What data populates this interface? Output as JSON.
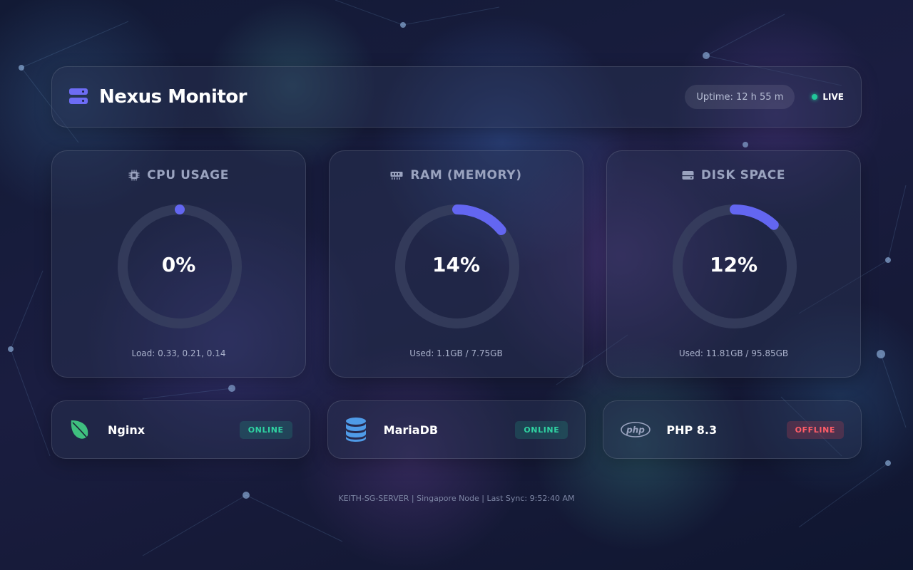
{
  "header": {
    "title": "Nexus Monitor",
    "uptime": "Uptime: 12 h 55 m",
    "live_label": "LIVE",
    "brand_icon": "server-icon"
  },
  "stats": [
    {
      "key": "cpu",
      "label": "CPU USAGE",
      "icon": "cpu-chip-icon",
      "value_text": "0%",
      "percent": 0,
      "footer": "Load: 0.33, 0.21, 0.14"
    },
    {
      "key": "ram",
      "label": "RAM (MEMORY)",
      "icon": "memory-icon",
      "value_text": "14%",
      "percent": 14,
      "footer": "Used: 1.1GB / 7.75GB"
    },
    {
      "key": "disk",
      "label": "DISK SPACE",
      "icon": "hard-drive-icon",
      "value_text": "12%",
      "percent": 12,
      "footer": "Used: 11.81GB / 95.85GB"
    }
  ],
  "services": [
    {
      "name": "Nginx",
      "status": "ONLINE",
      "icon": "leaf-icon"
    },
    {
      "name": "MariaDB",
      "status": "ONLINE",
      "icon": "database-icon"
    },
    {
      "name": "PHP 8.3",
      "status": "OFFLINE",
      "icon": "php-icon"
    }
  ],
  "footer": {
    "text": "KEITH-SG-SERVER | Singapore Node | Last Sync: 9:52:40 AM"
  },
  "colors": {
    "accent": "#6366f1",
    "track": "#3a4160",
    "online": "#22c79a",
    "offline": "#ff5d68"
  }
}
